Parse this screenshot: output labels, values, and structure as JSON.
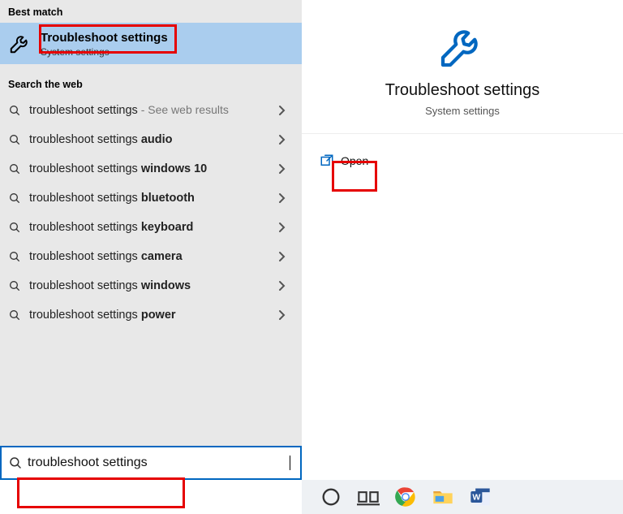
{
  "left": {
    "best_match_header": "Best match",
    "best_match": {
      "title": "Troubleshoot settings",
      "subtitle": "System settings"
    },
    "web_header": "Search the web",
    "web_items": [
      {
        "prefix": "troubleshoot settings",
        "bold": "",
        "hint": " - See web results"
      },
      {
        "prefix": "troubleshoot settings ",
        "bold": "audio",
        "hint": ""
      },
      {
        "prefix": "troubleshoot settings ",
        "bold": "windows 10",
        "hint": ""
      },
      {
        "prefix": "troubleshoot settings ",
        "bold": "bluetooth",
        "hint": ""
      },
      {
        "prefix": "troubleshoot settings ",
        "bold": "keyboard",
        "hint": ""
      },
      {
        "prefix": "troubleshoot settings ",
        "bold": "camera",
        "hint": ""
      },
      {
        "prefix": "troubleshoot settings ",
        "bold": "windows",
        "hint": ""
      },
      {
        "prefix": "troubleshoot settings ",
        "bold": "power",
        "hint": ""
      }
    ],
    "search_value": "troubleshoot settings"
  },
  "right": {
    "title": "Troubleshoot settings",
    "subtitle": "System settings",
    "open_label": "Open"
  }
}
